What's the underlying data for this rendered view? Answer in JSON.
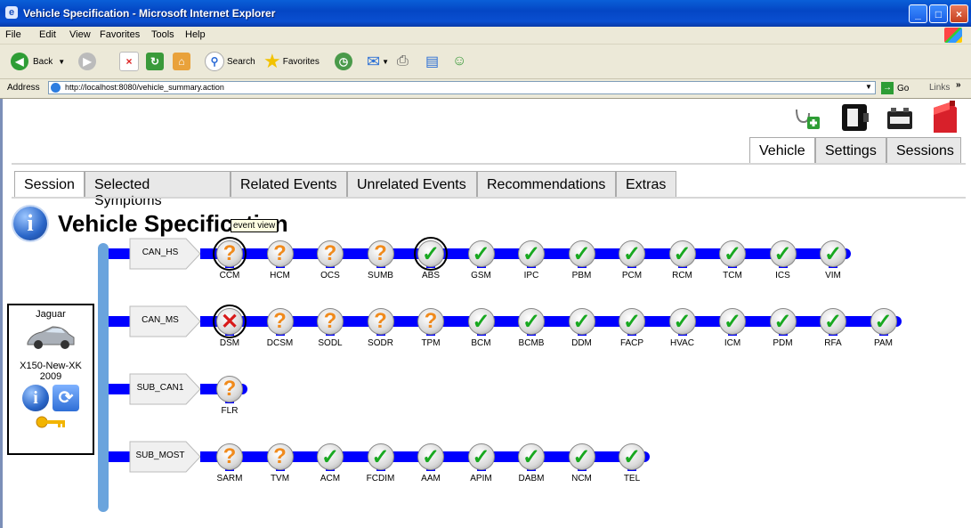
{
  "window": {
    "title": "Vehicle Specification - Microsoft Internet Explorer"
  },
  "menu": [
    "File",
    "Edit",
    "View",
    "Favorites",
    "Tools",
    "Help"
  ],
  "toolbar": {
    "back": "Back",
    "search": "Search",
    "favorites": "Favorites"
  },
  "address": {
    "label": "Address",
    "url": "http://localhost:8080/vehicle_summary.action",
    "go": "Go",
    "links": "Links"
  },
  "app_icons": [
    "stethoscope-icon",
    "ecu-icon",
    "battery-icon",
    "fuel-can-icon"
  ],
  "top_tabs": [
    "Vehicle",
    "Settings",
    "Sessions"
  ],
  "sub_tabs": [
    "Session",
    "Selected Symptoms",
    "Related Events",
    "Unrelated Events",
    "Recommendations",
    "Extras"
  ],
  "page_title": "Vehicle Specification",
  "tooltip": "event view",
  "vehicle": {
    "make": "Jaguar",
    "model": "X150-New-XK",
    "year": "2009"
  },
  "buses": [
    {
      "name": "CAN_HS",
      "modules": [
        {
          "label": "CCM",
          "status": "unknown",
          "selected": true
        },
        {
          "label": "HCM",
          "status": "unknown"
        },
        {
          "label": "OCS",
          "status": "unknown"
        },
        {
          "label": "SUMB",
          "status": "unknown"
        },
        {
          "label": "ABS",
          "status": "ok",
          "selected": true
        },
        {
          "label": "GSM",
          "status": "ok"
        },
        {
          "label": "IPC",
          "status": "ok"
        },
        {
          "label": "PBM",
          "status": "ok"
        },
        {
          "label": "PCM",
          "status": "ok"
        },
        {
          "label": "RCM",
          "status": "ok"
        },
        {
          "label": "TCM",
          "status": "ok"
        },
        {
          "label": "ICS",
          "status": "ok"
        },
        {
          "label": "VIM",
          "status": "ok"
        }
      ]
    },
    {
      "name": "CAN_MS",
      "modules": [
        {
          "label": "DSM",
          "status": "error",
          "selected": true
        },
        {
          "label": "DCSM",
          "status": "unknown"
        },
        {
          "label": "SODL",
          "status": "unknown"
        },
        {
          "label": "SODR",
          "status": "unknown"
        },
        {
          "label": "TPM",
          "status": "unknown"
        },
        {
          "label": "BCM",
          "status": "ok"
        },
        {
          "label": "BCMB",
          "status": "ok"
        },
        {
          "label": "DDM",
          "status": "ok"
        },
        {
          "label": "FACP",
          "status": "ok"
        },
        {
          "label": "HVAC",
          "status": "ok"
        },
        {
          "label": "ICM",
          "status": "ok"
        },
        {
          "label": "PDM",
          "status": "ok"
        },
        {
          "label": "RFA",
          "status": "ok"
        },
        {
          "label": "PAM",
          "status": "ok"
        }
      ]
    },
    {
      "name": "SUB_CAN1",
      "modules": [
        {
          "label": "FLR",
          "status": "unknown"
        }
      ]
    },
    {
      "name": "SUB_MOST",
      "modules": [
        {
          "label": "SARM",
          "status": "unknown"
        },
        {
          "label": "TVM",
          "status": "unknown"
        },
        {
          "label": "ACM",
          "status": "ok"
        },
        {
          "label": "FCDIM",
          "status": "ok"
        },
        {
          "label": "AAM",
          "status": "ok"
        },
        {
          "label": "APIM",
          "status": "ok"
        },
        {
          "label": "DABM",
          "status": "ok"
        },
        {
          "label": "NCM",
          "status": "ok"
        },
        {
          "label": "TEL",
          "status": "ok"
        }
      ]
    }
  ]
}
